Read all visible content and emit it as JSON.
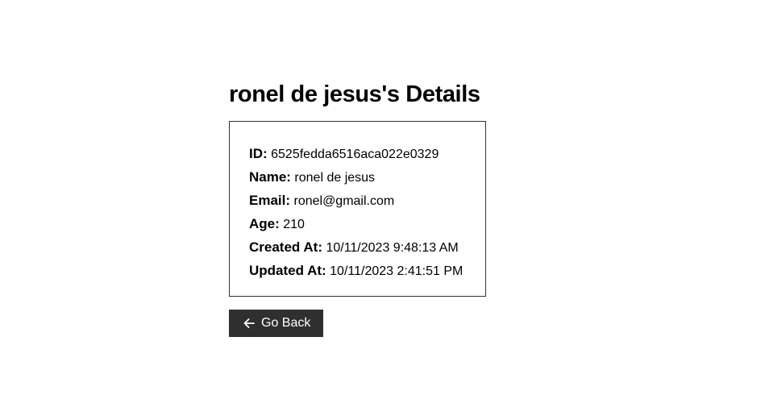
{
  "page": {
    "title": "ronel de jesus's Details"
  },
  "details": [
    {
      "label": "ID:",
      "value": "6525fedda6516aca022e0329"
    },
    {
      "label": "Name:",
      "value": "ronel de jesus"
    },
    {
      "label": "Email:",
      "value": "ronel@gmail.com"
    },
    {
      "label": "Age:",
      "value": "210"
    },
    {
      "label": "Created At:",
      "value": "10/11/2023 9:48:13 AM"
    },
    {
      "label": "Updated At:",
      "value": "10/11/2023 2:41:51 PM"
    }
  ],
  "actions": {
    "back_label": "Go Back",
    "back_icon": "arrow-left-icon"
  },
  "colors": {
    "button_bg": "#2f2f2f",
    "button_text": "#ffffff",
    "border": "#333333"
  }
}
